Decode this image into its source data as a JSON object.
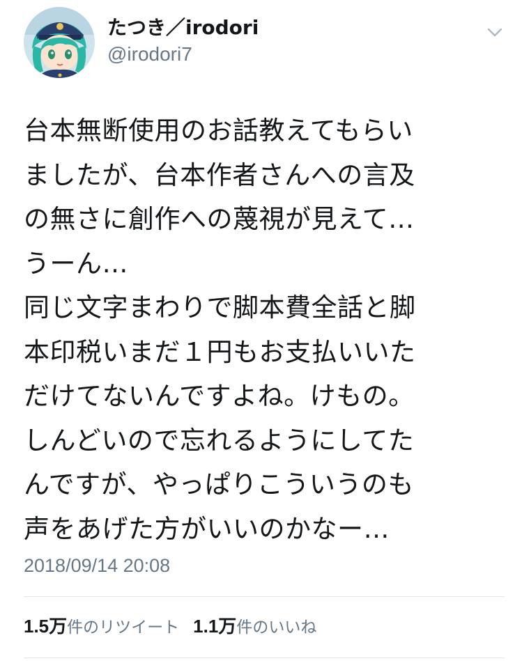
{
  "user": {
    "display_name": "たつき／irodori",
    "handle": "@irodori7",
    "avatar_icon": "anime-character-avatar"
  },
  "menu": {
    "icon": "chevron-down-icon"
  },
  "tweet": {
    "text_lines": [
      "台本無断使用のお話教えてもらい",
      "ましたが、台本作者さんへの言及",
      "の無さに創作への蔑視が見えて…",
      "うーん…",
      "同じ文字まわりで脚本費全話と脚",
      "本印税いまだ１円もお支払いいた",
      "だけてないんですよね。けもの。",
      "しんどいので忘れるようにしてた",
      "んですが、やっぱりこういうのも",
      "声をあげた方がいいのかなー…"
    ],
    "timestamp": "2018/09/14 20:08"
  },
  "stats": {
    "retweets": {
      "count": "1.5万",
      "label": "件のリツイート"
    },
    "likes": {
      "count": "1.1万",
      "label": "件のいいね"
    }
  },
  "colors": {
    "text_primary": "#14171a",
    "text_secondary": "#657786",
    "divider": "#e1e8ed",
    "background": "#ffffff"
  }
}
